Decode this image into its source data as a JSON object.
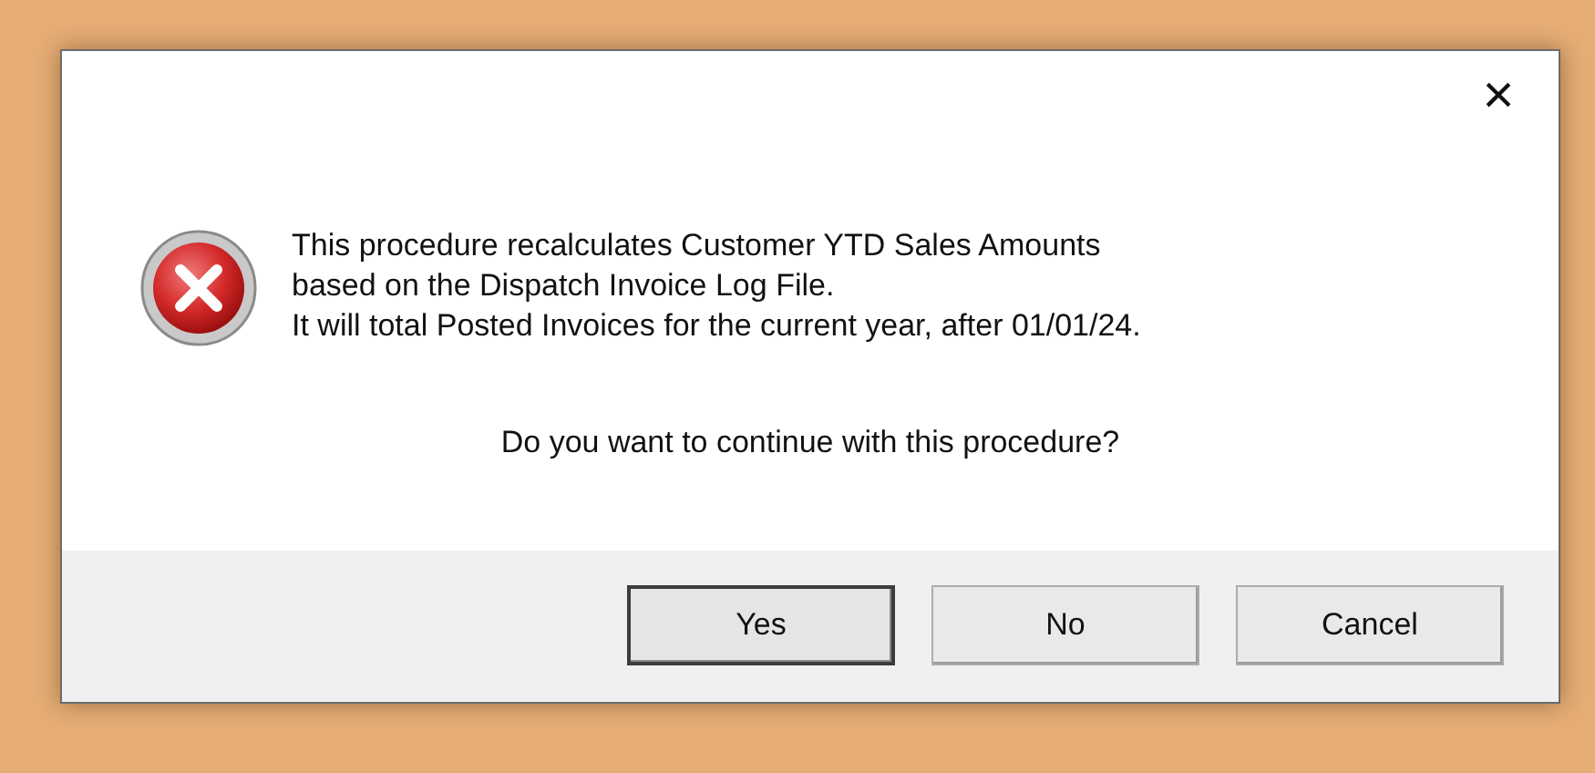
{
  "dialog": {
    "close": "×",
    "message": [
      "This procedure recalculates Customer YTD Sales Amounts",
      "based on the Dispatch Invoice Log File.",
      "It will total Posted Invoices for the current year, after 01/01/24."
    ],
    "question": "Do you want to continue with this procedure?",
    "buttons": [
      {
        "label": "Yes",
        "selected": true
      },
      {
        "label": "No",
        "selected": false
      },
      {
        "label": "Cancel",
        "selected": false
      }
    ]
  }
}
